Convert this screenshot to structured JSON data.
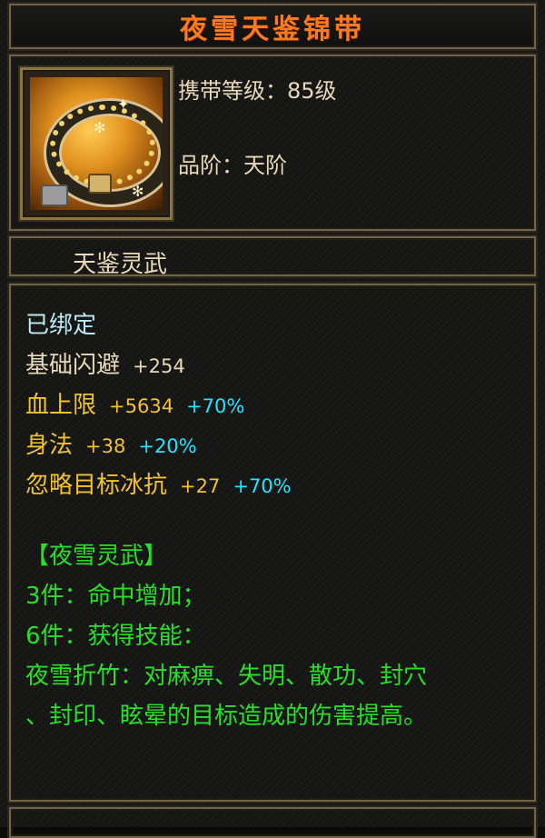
{
  "title": "夜雪天鉴锦带",
  "item_icon": "golden-belt-icon",
  "info": {
    "level": "携带等级：85级",
    "grade": "品阶：天阶"
  },
  "item_type": "天鉴灵武",
  "bound": "已绑定",
  "attributes": [
    {
      "name": "基础闪避",
      "value": "+254",
      "bonus": ""
    },
    {
      "name": "血上限",
      "value": "+5634",
      "bonus": "+70%"
    },
    {
      "name": "身法",
      "value": "+38",
      "bonus": "+20%"
    },
    {
      "name": "忽略目标冰抗",
      "value": "+27",
      "bonus": "+70%"
    }
  ],
  "set": {
    "name": "【夜雪灵武】",
    "bonus3": "3件：命中增加；",
    "bonus6": "6件：获得技能：",
    "skill_line1": "夜雪折竹：对麻痹、失明、散功、封穴",
    "skill_line2": "、封印、眩晕的目标造成的伤害提高。"
  },
  "colors": {
    "title": "#ff7a1f",
    "attribute_label": "#f2c232",
    "bonus": "#22e5ff",
    "set_text": "#28e028",
    "bound": "#bfe9f2"
  }
}
